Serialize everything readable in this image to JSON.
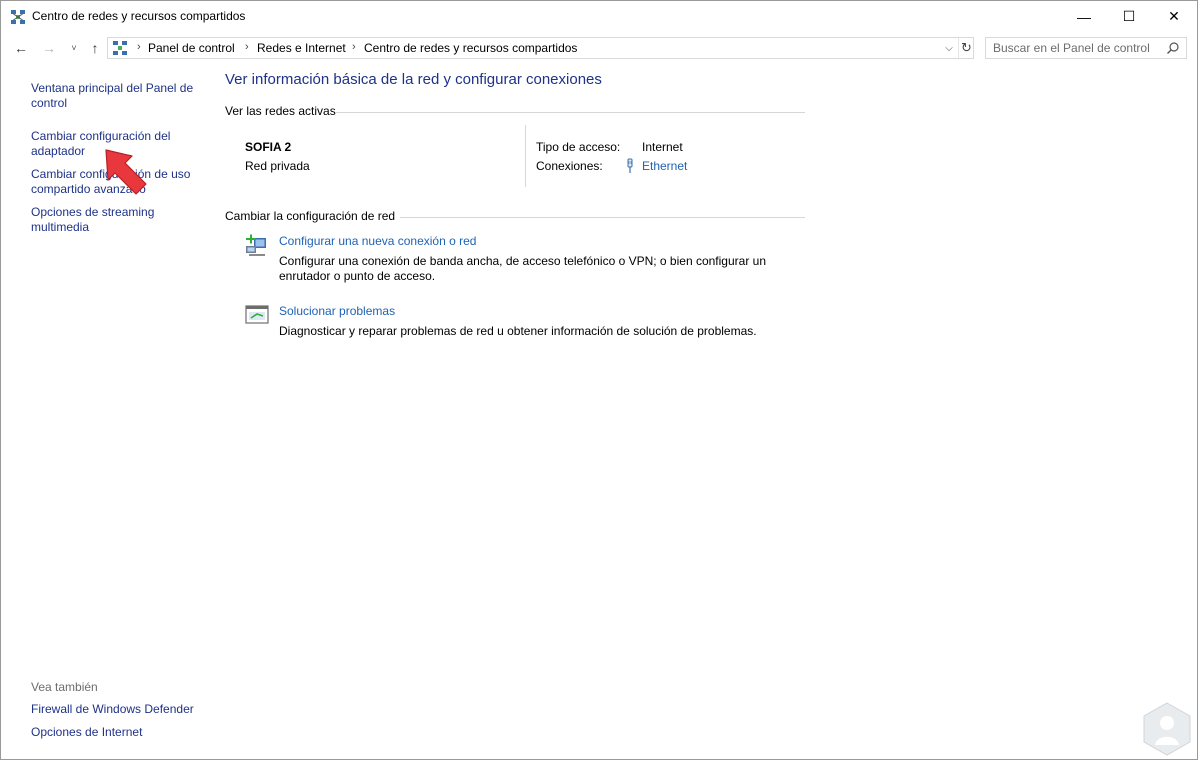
{
  "window": {
    "title": "Centro de redes y recursos compartidos",
    "minimize_glyph": "—",
    "maximize_glyph": "☐",
    "close_glyph": "✕"
  },
  "navigation": {
    "back_glyph": "←",
    "forward_glyph": "→",
    "recent_glyph": "˅",
    "up_glyph": "↑",
    "breadcrumb": [
      "Panel de control",
      "Redes e Internet",
      "Centro de redes y recursos compartidos"
    ],
    "separator": "›",
    "dropdown_glyph": "⌵",
    "refresh_glyph": "↻",
    "search_placeholder": "Buscar en el Panel de control"
  },
  "sidebar": {
    "links": [
      "Ventana principal del Panel de control",
      "Cambiar configuración del adaptador",
      "Cambiar configuración de uso compartido avanzado",
      "Opciones de streaming multimedia"
    ],
    "see_also_heading": "Vea también",
    "see_also_links": [
      "Firewall de Windows Defender",
      "Opciones de Internet"
    ]
  },
  "main": {
    "title": "Ver información básica de la red y configurar conexiones",
    "active_networks_heading": "Ver las redes activas",
    "network": {
      "name": "SOFIA 2",
      "type": "Red privada",
      "access_label": "Tipo de acceso:",
      "access_value": "Internet",
      "connections_label": "Conexiones:",
      "connection_link": "Ethernet"
    },
    "change_settings_heading": "Cambiar la configuración de red",
    "tasks": [
      {
        "link": "Configurar una nueva conexión o red",
        "description": "Configurar una conexión de banda ancha, de acceso telefónico o VPN; o bien configurar un enrutador o punto de acceso.",
        "icon": "new-connection-icon"
      },
      {
        "link": "Solucionar problemas",
        "description": "Diagnosticar y reparar problemas de red u obtener información de solución de problemas.",
        "icon": "troubleshoot-icon"
      }
    ]
  },
  "colors": {
    "link_dark": "#1e3287",
    "link_blue": "#1e62b5",
    "annotation_red": "#e8383d"
  }
}
